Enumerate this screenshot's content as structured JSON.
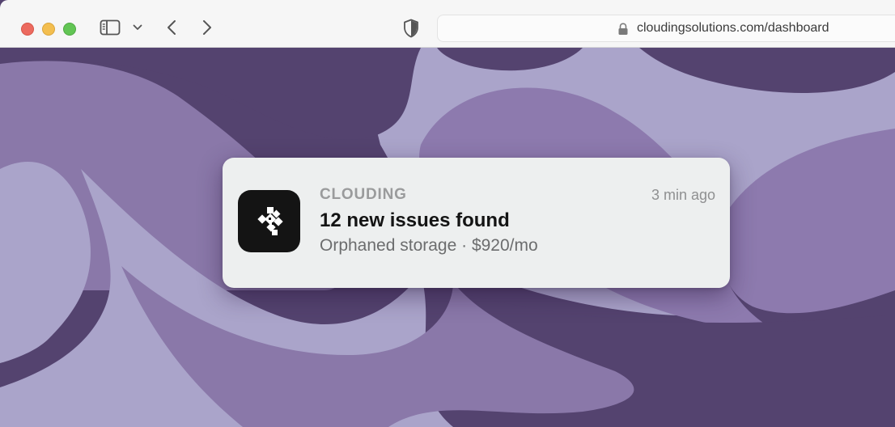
{
  "browser": {
    "url": "cloudingsolutions.com/dashboard",
    "icons": {
      "sidebar": "sidebar-toggle-icon",
      "dropdown": "chevron-down-icon",
      "back": "chevron-left-icon",
      "forward": "chevron-right-icon",
      "privacy": "shield-icon",
      "secure": "lock-icon"
    }
  },
  "notification": {
    "app_name": "CLOUDING",
    "time": "3 min ago",
    "title": "12 new issues found",
    "body": "Orphaned storage · $920/mo",
    "icon": "clouding-logo-icon"
  },
  "colors": {
    "wallpaper_dark": "#54436f",
    "wallpaper_mid": "#8c7aad",
    "wallpaper_light": "#a9a3cb",
    "card_bg": "#edefef"
  }
}
